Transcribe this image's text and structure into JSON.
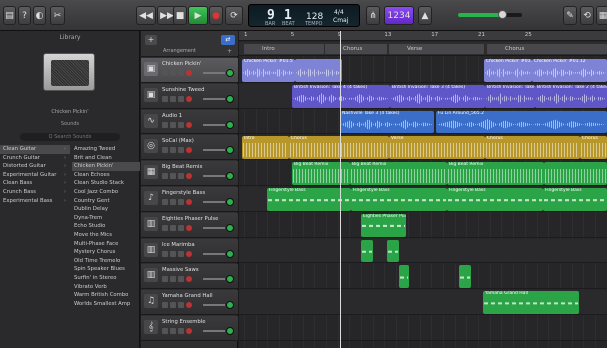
{
  "toolbar": {
    "lcd_bar": "9",
    "lcd_beat": "1",
    "lcd_tempo": "128",
    "lcd_sig_top": "4/4",
    "lcd_key": "Cmaj",
    "lcd_label_bar": "BAR",
    "lcd_label_beat": "BEAT",
    "lcd_label_tempo": "TEMPO",
    "tuner_label": "1234",
    "colors": {
      "play": "#2faa44",
      "record": "#d12a2a",
      "accent": "#7a38d8",
      "volume": "#2bb24c"
    }
  },
  "library": {
    "title": "Library",
    "preset_name": "Chicken Pickin'",
    "sounds_title": "Sounds",
    "search_placeholder": "Q  Search Sounds",
    "categories": [
      "Clean Guitar",
      "Crunch Guitar",
      "Distorted Guitar",
      "Experimental Guitar",
      "Clean Bass",
      "Crunch Bass",
      "Experimental Bass"
    ],
    "selected_category": 0,
    "presets": [
      "Amazing Tweed",
      "Brit and Clean",
      "Chicken Pickin'",
      "Clean Echoes",
      "Clean Studio Stack",
      "Cool Jazz Combo",
      "Country Gent",
      "Dublin Delay",
      "Dyna-Trem",
      "Echo Studio",
      "Move the Mics",
      "Multi-Phase Face",
      "Mystery Chorus",
      "Old Time Tremelo",
      "Spin Speaker Blues",
      "Surfin' in Stereo",
      "Vibrato Verb",
      "Warm British Combo",
      "Worlds Smallest Amp"
    ],
    "selected_preset": 2
  },
  "arrangement": {
    "label": "Arrangement",
    "ruler_numbers": [
      "1",
      "5",
      "9",
      "13",
      "17",
      "21",
      "25"
    ],
    "markers": [
      "Intro",
      "Chorus",
      "Verse",
      "Chorus"
    ]
  },
  "tracks": [
    {
      "name": "Chicken Pickin'",
      "icon": "guitar-amp-icon",
      "color": "#7e83d6"
    },
    {
      "name": "Sunshine Tweed",
      "icon": "guitar-amp-icon",
      "color": "#7e83d6"
    },
    {
      "name": "Audio 1",
      "icon": "waveform-icon",
      "color": "#3a6ec9"
    },
    {
      "name": "SoCal (Max)",
      "icon": "drum-kit-icon",
      "color": "#c7a630"
    },
    {
      "name": "Big Beat Remix",
      "icon": "drum-machine-icon",
      "color": "#2da84b"
    },
    {
      "name": "Fingerstyle Bass",
      "icon": "bass-guitar-icon",
      "color": "#2da84b"
    },
    {
      "name": "Eighties Phaser Pulse",
      "icon": "keyboard-icon",
      "color": "#2da84b"
    },
    {
      "name": "Ice Marimba",
      "icon": "keyboard-icon",
      "color": "#2da84b"
    },
    {
      "name": "Massive Saws",
      "icon": "keyboard-icon",
      "color": "#2da84b"
    },
    {
      "name": "Yamaha Grand Hall",
      "icon": "piano-icon",
      "color": "#2da84b"
    },
    {
      "name": "String Ensemble",
      "icon": "violin-icon",
      "color": "#2da84b"
    }
  ],
  "regions": {
    "chicken": [
      "Chicken Pickin' #01.5",
      "Chicken Pickin' #01.11",
      "Chicken Pickin' #01.12"
    ],
    "sunshine": [
      "British Invasion: Take 4 (4 takes)",
      "British Invasion: Take 3 (4 takes)",
      "British Invasion: Take 3 (4 takes)",
      "British Invasion: Take 2 (4 takes)"
    ],
    "audio": [
      "Nashville Take 3 (4 takes)",
      "Fu Lin Around_565.2"
    ],
    "socal": [
      "Intro",
      "Chorus",
      "Verse",
      "Chorus",
      "Chorus"
    ],
    "bigbeat": [
      "Big Beat Remix",
      "Big Beat Remix",
      "Big Beat Remix"
    ],
    "bass": [
      "Fingerstyle Bass",
      "Fingerstyle Bass",
      "Fingerstyle Bass",
      "Fingerstyle Bass"
    ],
    "eighties": [
      "Eighties Phaser Pulse"
    ],
    "yamaha": [
      "Yamaha Grand Hall"
    ]
  }
}
